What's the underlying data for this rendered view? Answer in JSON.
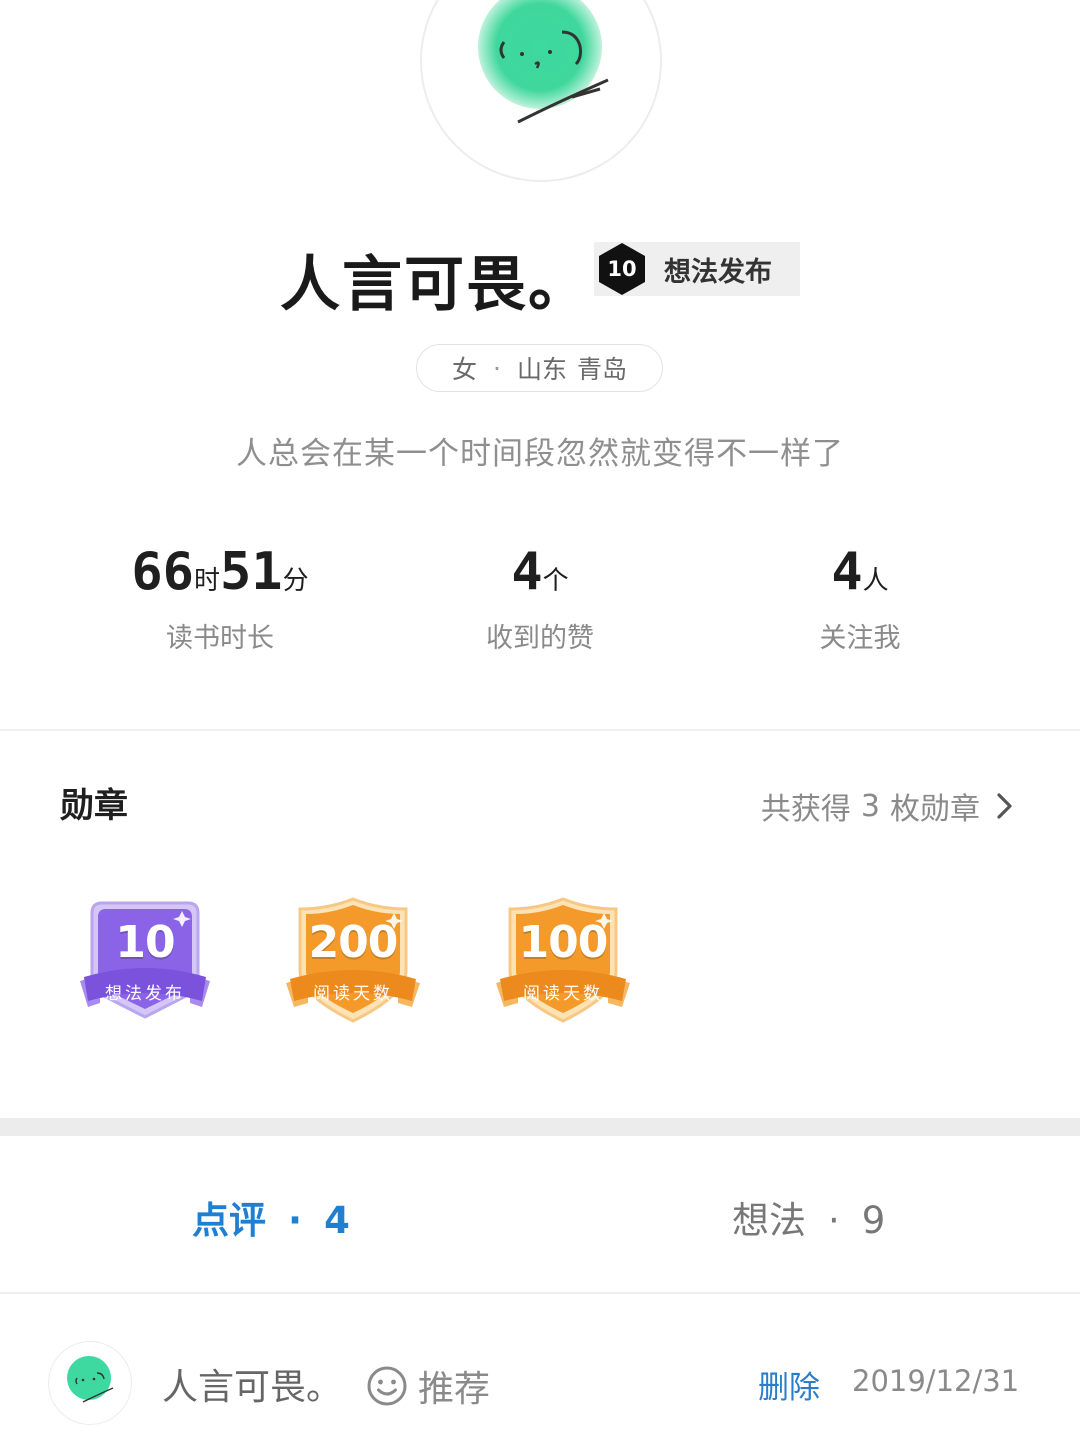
{
  "profile": {
    "name": "人言可畏。",
    "badge_count": "10",
    "badge_label": "想法发布",
    "gender": "女",
    "separator": "·",
    "province": "山东",
    "city": "青岛",
    "signature": "人总会在某一个时间段忽然就变得不一样了"
  },
  "stats": {
    "reading_hours": "66",
    "hour_unit": "时",
    "reading_minutes": "51",
    "minute_unit": "分",
    "reading_label": "读书时长",
    "likes_value": "4",
    "likes_unit": "个",
    "likes_label": "收到的赞",
    "followers_value": "4",
    "followers_unit": "人",
    "followers_label": "关注我"
  },
  "medals": {
    "title": "勋章",
    "more_prefix": "共获得",
    "more_count": "3",
    "more_suffix": "枚勋章",
    "items": [
      {
        "number": "10",
        "label": "想法发布",
        "color": "#8a63e6"
      },
      {
        "number": "200",
        "label": "阅读天数",
        "color": "#f39a2a"
      },
      {
        "number": "100",
        "label": "阅读天数",
        "color": "#f39a2a"
      }
    ]
  },
  "tabs": [
    {
      "label": "点评",
      "separator": "·",
      "count": "4",
      "active": true
    },
    {
      "label": "想法",
      "separator": "·",
      "count": "9",
      "active": false
    }
  ],
  "review": {
    "user": "人言可畏。",
    "rating_label": "推荐",
    "delete_label": "删除",
    "date": "2019/12/31"
  },
  "colors": {
    "accent": "#1f7fd1",
    "avatar_green": "#3ed9a0",
    "purple_medal": "#8a63e6",
    "orange_medal": "#f39a2a"
  }
}
